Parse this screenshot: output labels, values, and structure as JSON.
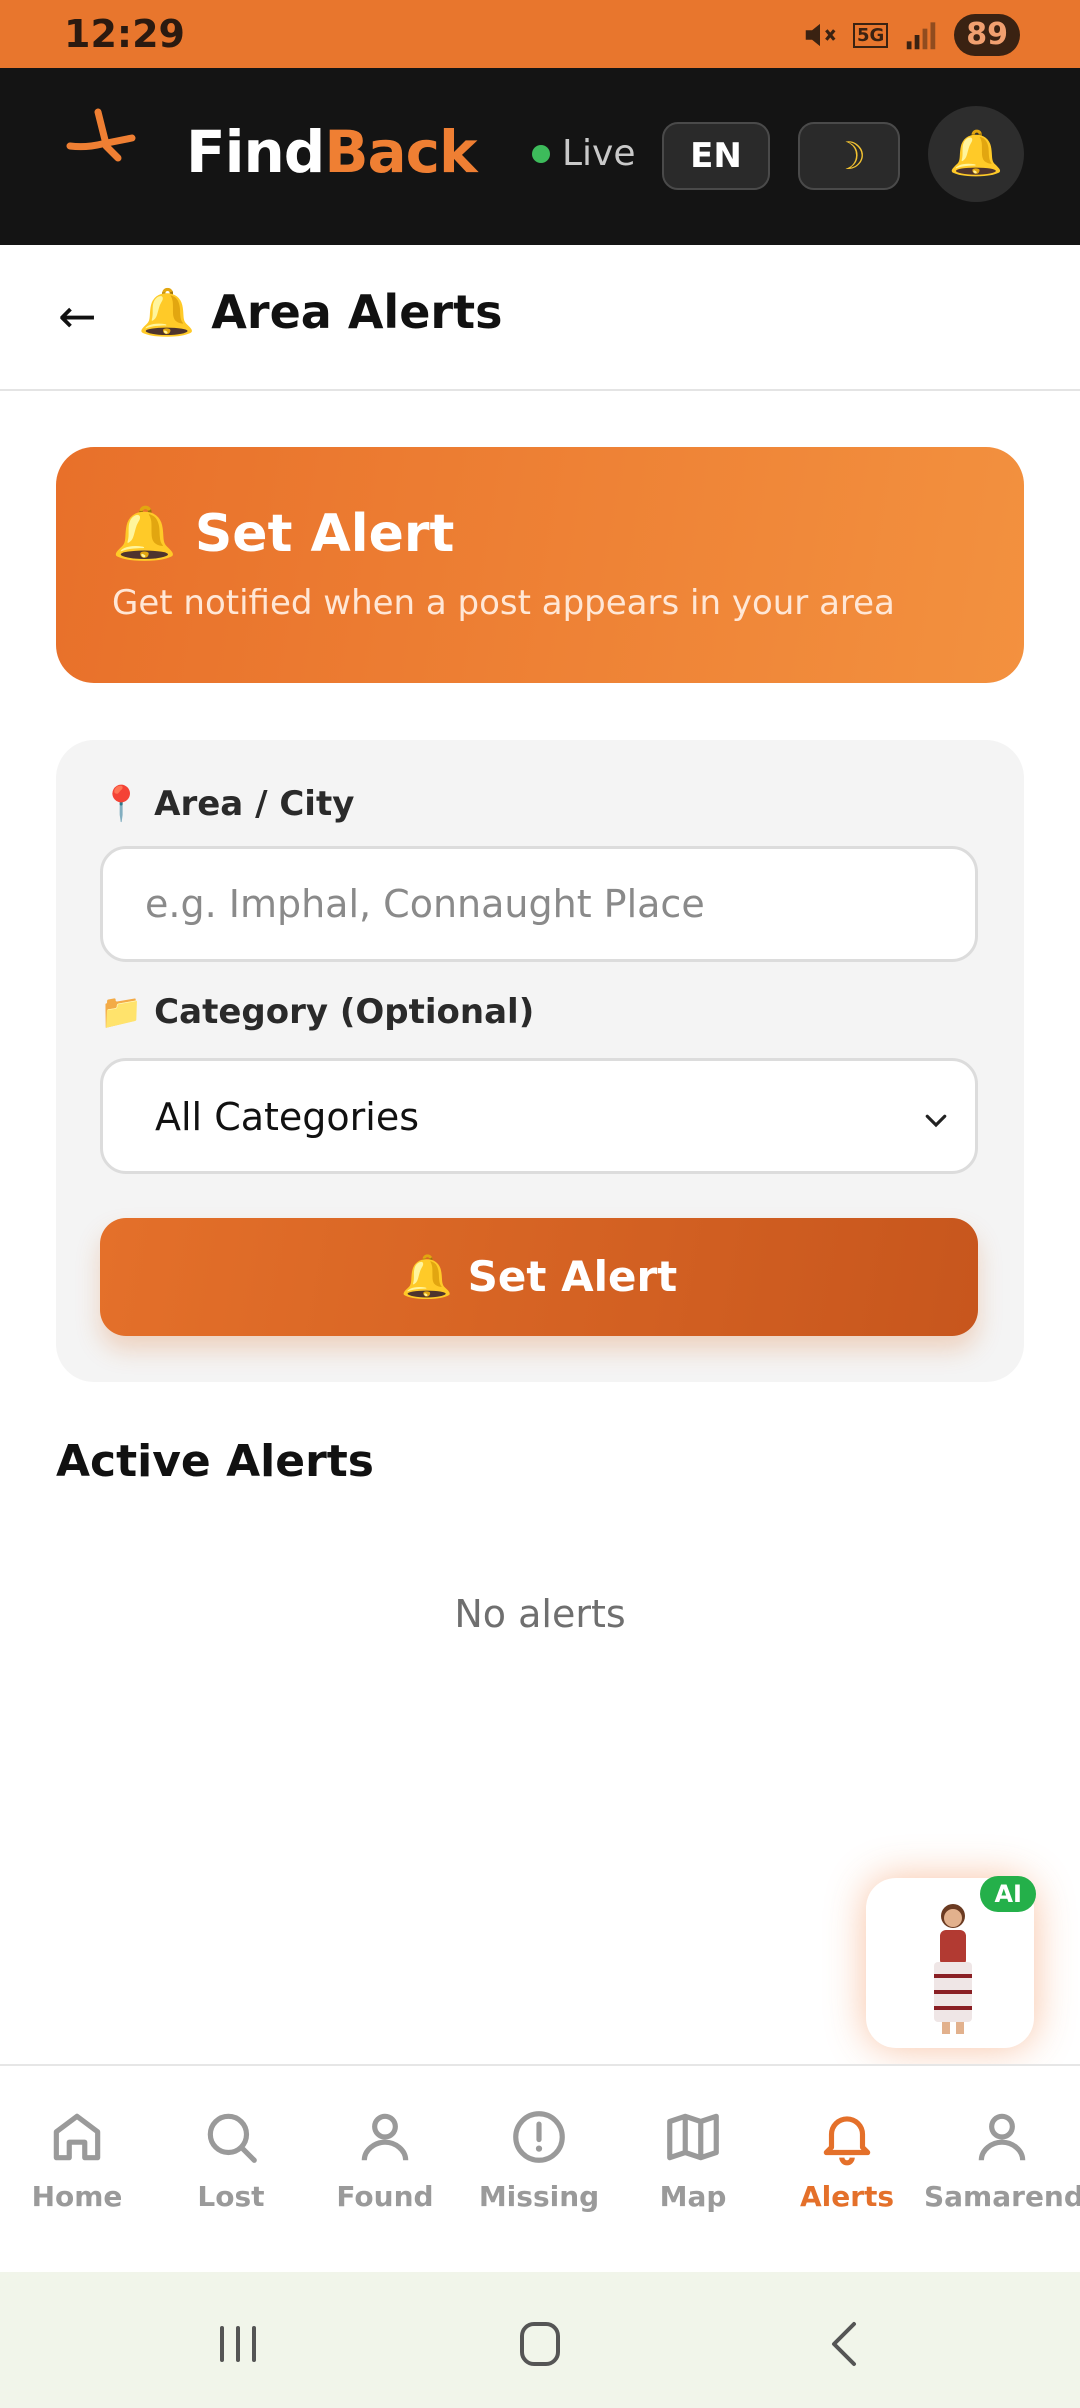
{
  "status_bar": {
    "time": "12:29",
    "battery": "89",
    "network": "5G"
  },
  "header": {
    "brand_find": "Find",
    "brand_back": "Back",
    "live_label": "Live",
    "lang_label": "EN",
    "theme_icon": "moon-icon",
    "bell_icon": "bell-icon"
  },
  "page": {
    "back_arrow": "←",
    "title": "🔔 Area Alerts"
  },
  "hero": {
    "title": "🔔 Set Alert",
    "subtitle": "Get notified when a post appears in your area"
  },
  "form": {
    "area_label": "📍 Area / City",
    "area_placeholder": "e.g. Imphal, Connaught Place",
    "area_value": "",
    "category_label": "📁 Category (Optional)",
    "category_selected": "All Categories",
    "submit_label": "🔔 Set Alert"
  },
  "active_alerts": {
    "title": "Active Alerts",
    "empty_text": "No alerts"
  },
  "ai_assistant": {
    "badge": "AI"
  },
  "nav": {
    "items": [
      {
        "label": "Home",
        "icon": "home-icon"
      },
      {
        "label": "Lost",
        "icon": "search-icon"
      },
      {
        "label": "Found",
        "icon": "user-icon"
      },
      {
        "label": "Missing",
        "icon": "alert-circle-icon"
      },
      {
        "label": "Map",
        "icon": "map-icon"
      },
      {
        "label": "Alerts",
        "icon": "bell-icon",
        "active": true
      },
      {
        "label": "Samarendra",
        "icon": "profile-icon"
      }
    ]
  },
  "colors": {
    "accent": "#e8762d",
    "header_bg": "#141414",
    "active_nav": "#e4702a"
  }
}
